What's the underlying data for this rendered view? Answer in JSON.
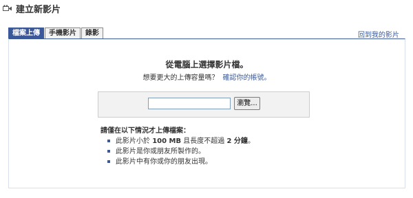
{
  "header": {
    "title": "建立新影片",
    "icon": "video-camera-icon"
  },
  "tabs": [
    {
      "label": "檔案上傳",
      "active": true
    },
    {
      "label": "手機影片",
      "active": false
    },
    {
      "label": "錄影",
      "active": false
    }
  ],
  "back_link": "回到我的影片",
  "main": {
    "heading": "從電腦上選擇影片檔。",
    "subline": "想要更大的上傳容量嗎？",
    "subline_link": "確認你的帳號。",
    "file_input_value": "",
    "browse_label": "瀏覽...",
    "requirements_title": "請僅在以下情況才上傳檔案：",
    "requirements": [
      {
        "pre": "此影片小於 ",
        "size": "100 MB",
        "mid": " 且長度不超過 ",
        "len": "2 分鐘",
        "post": "。"
      },
      {
        "text": "此影片是你或朋友所製作的。"
      },
      {
        "text": "此影片中有你或你的朋友出現。"
      }
    ]
  },
  "colors": {
    "accent": "#3b5998",
    "panel_bg": "#f2f2f2",
    "border": "#d8dfea"
  }
}
